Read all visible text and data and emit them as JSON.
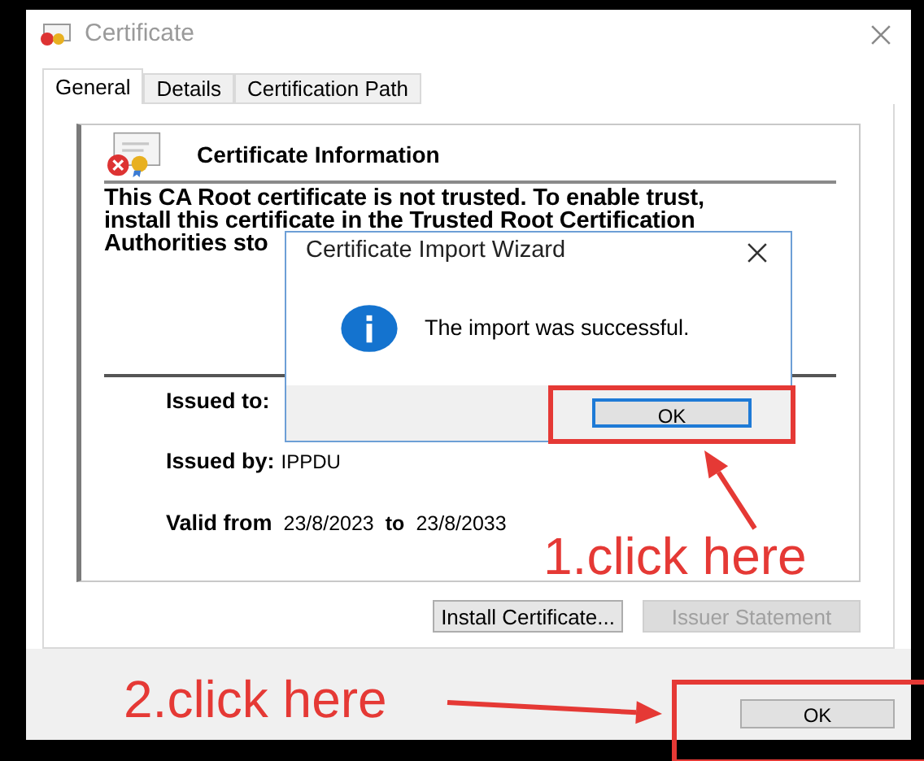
{
  "window": {
    "title": "Certificate",
    "tabs": [
      {
        "label": "General",
        "selected": true
      },
      {
        "label": "Details",
        "selected": false
      },
      {
        "label": "Certification Path",
        "selected": false
      }
    ],
    "info": {
      "heading": "Certificate Information",
      "message_lines": [
        "This CA Root certificate is not trusted. To enable trust,",
        "install this certificate in the Trusted Root Certification",
        "Authorities sto"
      ],
      "issued_to_label": "Issued to:",
      "issued_by_label": "Issued by:",
      "issued_by": "IPPDU",
      "valid_from_label": "Valid from",
      "valid_from": "23/8/2023",
      "to_label": "to",
      "valid_to": "23/8/2033"
    },
    "buttons": [
      {
        "label": "Install Certificate...",
        "disabled": false
      },
      {
        "label": "Issuer Statement",
        "disabled": true
      }
    ],
    "ok_button": "OK"
  },
  "dialog": {
    "title": "Certificate Import Wizard",
    "message": "The import was successful.",
    "ok_button": "OK"
  },
  "annotations": [
    {
      "text": "1.click here"
    },
    {
      "text": "2.click here"
    }
  ]
}
